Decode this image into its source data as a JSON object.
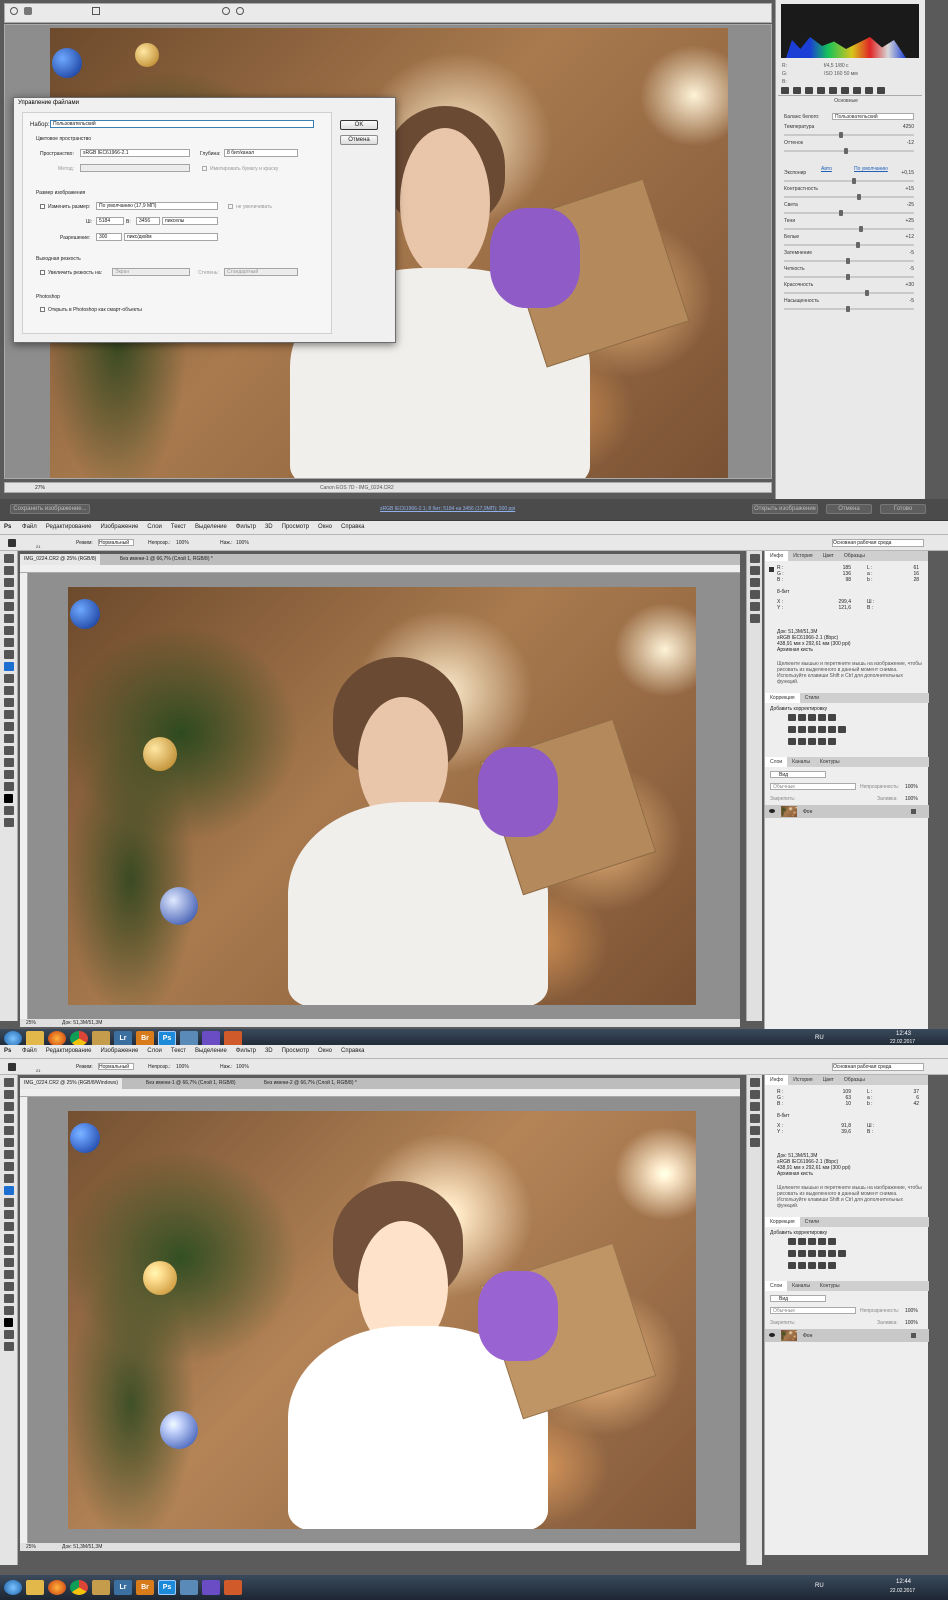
{
  "camera_raw": {
    "status_camera": "Canon EOS 7D - IMG_0224.CR2",
    "zoom": "27%",
    "exif": {
      "aperture": "f/4,5",
      "shutter": "1/80 с",
      "iso": "ISO 160",
      "focal": "50 мм",
      "r": "R:",
      "g": "G:",
      "b": "B:"
    },
    "section_title": "Основные",
    "wb_label": "Баланс белого:",
    "wb_value": "Пользовательский",
    "auto": "Авто",
    "default": "По умолчанию",
    "sliders": [
      {
        "label": "Температура",
        "value": "4250",
        "pct": 0.42
      },
      {
        "label": "Оттенок",
        "value": "-12",
        "pct": 0.46
      },
      {
        "label": "Экспонир",
        "value": "+0,15",
        "pct": 0.52
      },
      {
        "label": "Контрастность",
        "value": "+15",
        "pct": 0.56
      },
      {
        "label": "Света",
        "value": "-25",
        "pct": 0.42
      },
      {
        "label": "Тени",
        "value": "+25",
        "pct": 0.58
      },
      {
        "label": "Белые",
        "value": "+12",
        "pct": 0.55
      },
      {
        "label": "Затемнение",
        "value": "-5",
        "pct": 0.48
      },
      {
        "label": "Четкость",
        "value": "-5",
        "pct": 0.48
      },
      {
        "label": "Красочность",
        "value": "+30",
        "pct": 0.62
      },
      {
        "label": "Насыщенность",
        "value": "-5",
        "pct": 0.48
      }
    ],
    "bottom_link": "sRGB IEC61966-2.1; 8 бит; 5184 на 3456 (17,9МП); 300 ppi",
    "save_button": "Сохранить изображение...",
    "open_button": "Открыть изображение",
    "cancel_button": "Отмена",
    "done_button": "Готово"
  },
  "dialog": {
    "title": "Управление файлами",
    "preset_label": "Набор:",
    "preset_value": "Пользовательский",
    "ok": "OK",
    "cancel": "Отмена",
    "color_space_title": "Цветовое пространство",
    "space_label": "Пространство:",
    "space_value": "sRGB IEC61966-2.1",
    "depth_label": "Глубина:",
    "depth_value": "8 бит/канал",
    "method_label": "Метод:",
    "simulate": "Имитировать бумагу и краску",
    "size_title": "Размер изображения",
    "resize_label": "Изменить размер:",
    "resize_value": "По умолчанию (17,9 МП)",
    "no_enlarge": "не увеличивать",
    "w_label": "Ш:",
    "w_value": "5184",
    "h_label": "В:",
    "h_value": "3456",
    "unit_value": "пикселы",
    "res_label": "Разрешение:",
    "res_value": "300",
    "res_unit": "пикс/дюйм",
    "sharpen_title": "Выходная резкость",
    "sharpen_label": "Увеличить резкость на:",
    "sharpen_value": "Экран",
    "amount_label": "Степень:",
    "amount_value": "Стандартный",
    "ps_title": "Photoshop",
    "smart": "Открыть в Photoshop как смарт-объекты"
  },
  "menu": [
    "Файл",
    "Редактирование",
    "Изображение",
    "Слои",
    "Текст",
    "Выделение",
    "Фильтр",
    "3D",
    "Просмотр",
    "Окно",
    "Справка"
  ],
  "options": {
    "mode_label": "Режим:",
    "mode_value": "Нормальный",
    "opacity_label": "Непрозр.:",
    "opacity_value": "100%",
    "flow_label": "Наж.:",
    "flow_value": "100%",
    "workspace": "Основная рабочая среда",
    "brush_size": "21"
  },
  "panels": {
    "info_tabs": [
      "Инфо",
      "История",
      "Цвет",
      "Образцы"
    ],
    "corr_tabs": [
      "Коррекция",
      "Стили"
    ],
    "corr_title": "Добавить корректировку",
    "layer_tabs": [
      "Слои",
      "Каналы",
      "Контуры"
    ],
    "kind": "Вид",
    "blend": "Обычные",
    "opacity_label": "Непрозрачность:",
    "opacity_value": "100%",
    "lock_label": "Закрепить:",
    "fill_label": "Заливка:",
    "fill_value": "100%",
    "layer_name": "Фон",
    "bit": "8-бит",
    "hint": "Щелкните мышью и перетяните мышь на изображение, чтобы рисовать из выделенного в данный момент снимка. Используйте клавиши Shift и Ctrl для дополнительных функций.",
    "doc_line1": "Док: 51,3M/51,3M",
    "doc_line2": "sRGB IEC61966-2.1 (8bpc)",
    "doc_line3": "438,91 мм x 292,61 мм (300 ppi)",
    "doc_line4": "Архивная кисть"
  },
  "ps1": {
    "tabs": [
      "IMG_0224.CR2 @ 25% (RGB/8)",
      "Без имени-1 @ 66,7% (Слой 1, RGB/8) *"
    ],
    "info": {
      "r": "185",
      "g": "136",
      "b": "98",
      "l": "61",
      "a": "16",
      "bb": "28",
      "x": "299,4",
      "y": "121,6"
    },
    "status_zoom": "25%",
    "status_doc": "Док: 51,3M/51,3M"
  },
  "ps2": {
    "tabs": [
      "IMG_0224.CR2 @ 25% (RGB/8/Windows)",
      "Без имени-1 @ 66,7% (Слой 1, RGB/8)",
      "Без имени-2 @ 66,7% (Слой 1, RGB/8) *"
    ],
    "info": {
      "r": "109",
      "g": "63",
      "b": "10",
      "l": "37",
      "a": "6",
      "bb": "42",
      "x": "91,8",
      "y": "39,6"
    },
    "status_zoom": "25%",
    "status_doc": "Док: 51,3M/51,3M"
  },
  "taskbar1": {
    "lang": "RU",
    "time": "12:43",
    "date": "22.02.2017"
  },
  "taskbar2": {
    "lang": "RU",
    "time": "12:44",
    "date": "22.02.2017"
  },
  "taskbar_apps": [
    "Lr",
    "Br",
    "Ps"
  ],
  "colors": {
    "ps_blue": "#2d8ce6",
    "lr": "#3b6fa0",
    "br": "#d77b1b",
    "ps": "#1c8ad8"
  }
}
